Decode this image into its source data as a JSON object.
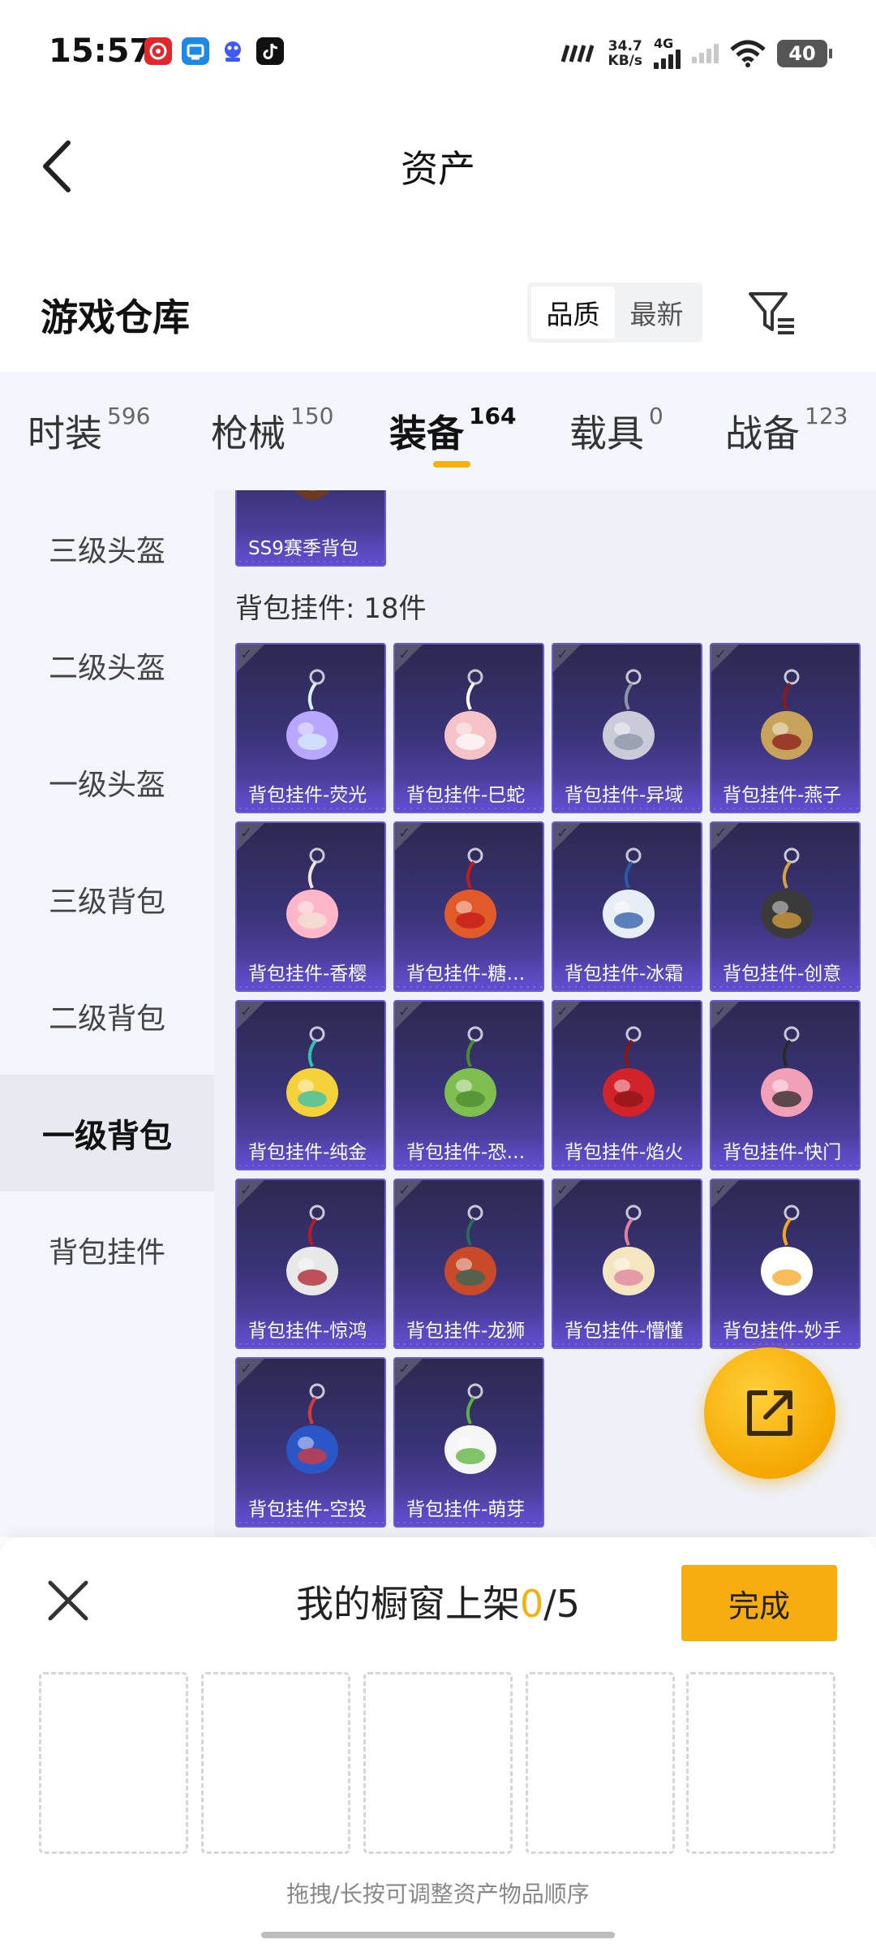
{
  "status_bar": {
    "time": "15:57",
    "net_speed": "34.7",
    "net_unit": "KB/s",
    "network_type": "4G",
    "battery": "40",
    "app_icons": [
      "netease-music-icon",
      "tv-app-icon",
      "baidu-app-icon",
      "tiktok-icon"
    ]
  },
  "header": {
    "title": "资产"
  },
  "section": {
    "title": "游戏仓库",
    "sort_options": [
      "品质",
      "最新"
    ],
    "active_sort": "品质"
  },
  "tabs": [
    {
      "label": "时装",
      "count": "596"
    },
    {
      "label": "枪械",
      "count": "150"
    },
    {
      "label": "装备",
      "count": "164",
      "active": true
    },
    {
      "label": "载具",
      "count": "0"
    },
    {
      "label": "战备",
      "count": "123"
    }
  ],
  "sidebar": {
    "items": [
      "三级头盔",
      "二级头盔",
      "一级头盔",
      "三级背包",
      "二级背包",
      "一级背包",
      "背包挂件"
    ],
    "active": "一级背包"
  },
  "content": {
    "previous_item_label": "SS9赛季背包",
    "group_label": "背包挂件: 18件",
    "items": [
      {
        "label": "背包挂件-荧光",
        "icon": "drink-cup-charm-icon"
      },
      {
        "label": "背包挂件-巳蛇",
        "icon": "pink-fox-charm-icon"
      },
      {
        "label": "背包挂件-异域",
        "icon": "silver-wings-charm-icon"
      },
      {
        "label": "背包挂件-燕子",
        "icon": "swallow-charm-icon"
      },
      {
        "label": "背包挂件-香樱",
        "icon": "cherry-blossom-charm-icon"
      },
      {
        "label": "背包挂件-糖葫芦",
        "icon": "candied-haws-charm-icon"
      },
      {
        "label": "背包挂件-冰霜",
        "icon": "robot-charm-icon"
      },
      {
        "label": "背包挂件-创意",
        "icon": "canister-charm-icon"
      },
      {
        "label": "背包挂件-纯金",
        "icon": "bottle-opener-charm-icon"
      },
      {
        "label": "背包挂件-恐龙蛋",
        "icon": "dino-egg-charm-icon"
      },
      {
        "label": "背包挂件-焰火",
        "icon": "chinese-knot-charm-icon"
      },
      {
        "label": "背包挂件-快门",
        "icon": "pink-camera-charm-icon"
      },
      {
        "label": "背包挂件-惊鸿",
        "icon": "tassel-ring-charm-icon"
      },
      {
        "label": "背包挂件-龙狮",
        "icon": "lion-dance-charm-icon"
      },
      {
        "label": "背包挂件-懵懂",
        "icon": "feather-charm-icon"
      },
      {
        "label": "背包挂件-妙手",
        "icon": "daisy-charm-icon"
      },
      {
        "label": "背包挂件-空投",
        "icon": "helmet-charm-icon"
      },
      {
        "label": "背包挂件-萌芽",
        "icon": "sprout-charm-icon"
      }
    ]
  },
  "bottom_sheet": {
    "title": "我的橱窗上架",
    "count_current": "0",
    "count_total": "/5",
    "done_label": "完成",
    "slot_count": 5,
    "hint": "拖拽/长按可调整资产物品顺序"
  },
  "colors": {
    "accent": "#f5b20c",
    "card_bg": "#3a3479",
    "card_border": "#6c5ad0",
    "sidebar_bg": "#f2f5fb"
  }
}
